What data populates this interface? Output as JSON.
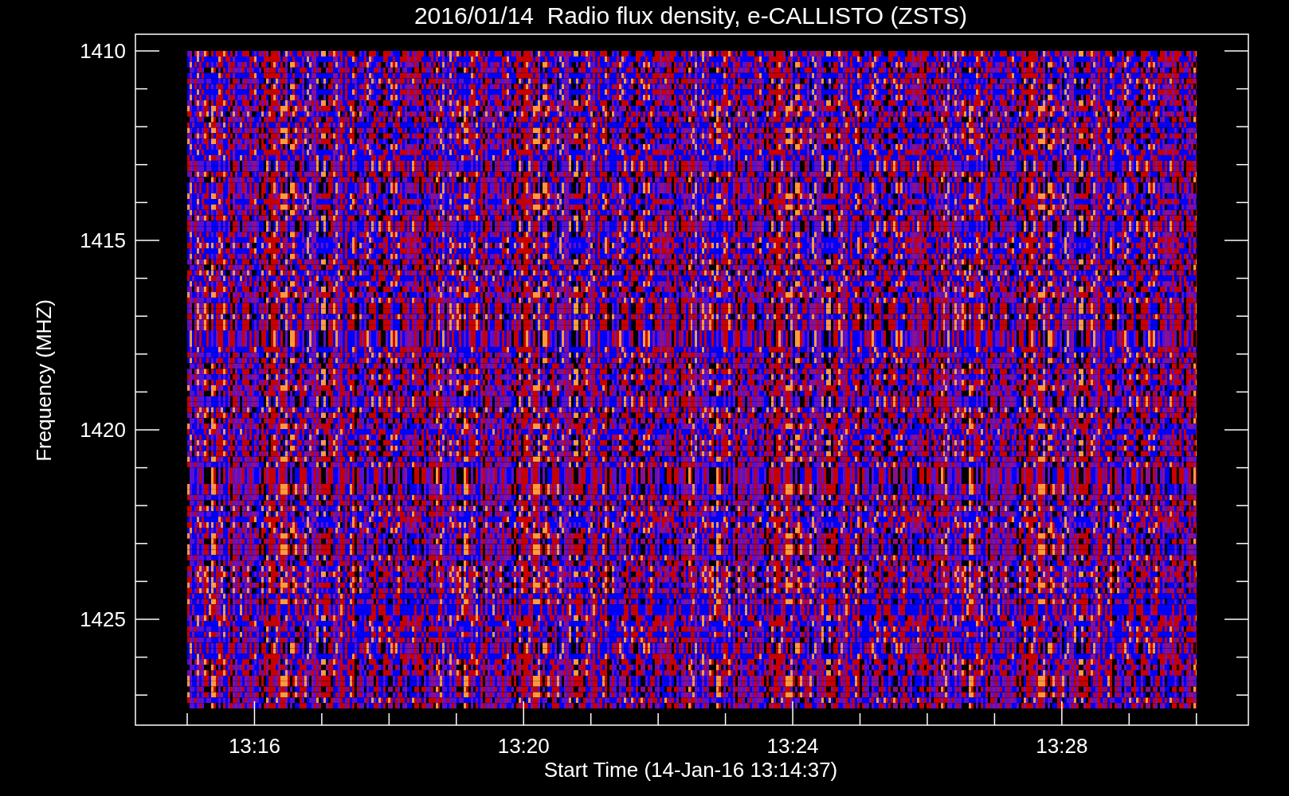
{
  "title": "2016/01/14  Radio flux density, e-CALLISTO (ZSTS)",
  "y_axis": {
    "label": "Frequency (MHZ)",
    "ticks": [
      "1410",
      "1415",
      "1420",
      "1425"
    ]
  },
  "x_axis": {
    "label": "Start Time (14-Jan-16 13:14:37)",
    "ticks": [
      "13:16",
      "13:20",
      "13:24",
      "13:28"
    ]
  }
}
